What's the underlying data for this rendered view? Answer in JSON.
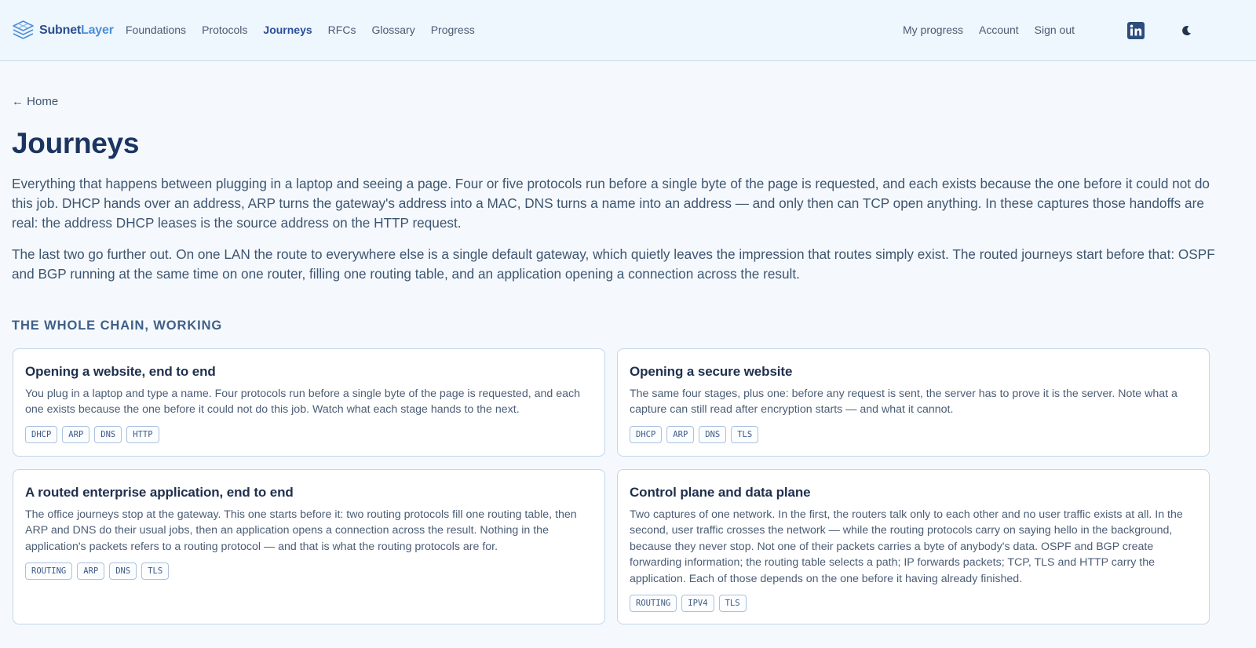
{
  "brand": {
    "name_part1": "Subnet",
    "name_part2": "Layer"
  },
  "nav": {
    "items": [
      {
        "label": "Foundations"
      },
      {
        "label": "Protocols"
      },
      {
        "label": "Journeys"
      },
      {
        "label": "RFCs"
      },
      {
        "label": "Glossary"
      },
      {
        "label": "Progress"
      }
    ],
    "active": "Journeys",
    "right": [
      {
        "label": "My progress"
      },
      {
        "label": "Account"
      },
      {
        "label": "Sign out"
      }
    ],
    "icons": [
      "linkedin-icon",
      "moon-icon"
    ]
  },
  "breadcrumb": {
    "back_label": "← Home"
  },
  "page": {
    "title": "Journeys",
    "intro_1": "Everything that happens between plugging in a laptop and seeing a page. Four or five protocols run before a single byte of the page is requested, and each exists because the one before it could not do this job. DHCP hands over an address, ARP turns the gateway's address into a MAC, DNS turns a name into an address — and only then can TCP open anything. In these captures those handoffs are real: the address DHCP leases is the source address on the HTTP request.",
    "intro_2": "The last two go further out. On one LAN the route to everywhere else is a single default gateway, which quietly leaves the impression that routes simply exist. The routed journeys start before that: OSPF and BGP running at the same time on one router, filling one routing table, and an application opening a connection across the result."
  },
  "section": {
    "heading": "THE WHOLE CHAIN, WORKING"
  },
  "cards": [
    {
      "title": "Opening a website, end to end",
      "description": "You plug in a laptop and type a name. Four protocols run before a single byte of the page is requested, and each one exists because the one before it could not do this job. Watch what each stage hands to the next.",
      "tags": [
        "DHCP",
        "ARP",
        "DNS",
        "HTTP"
      ]
    },
    {
      "title": "Opening a secure website",
      "description": "The same four stages, plus one: before any request is sent, the server has to prove it is the server. Note what a capture can still read after encryption starts — and what it cannot.",
      "tags": [
        "DHCP",
        "ARP",
        "DNS",
        "TLS"
      ]
    },
    {
      "title": "A routed enterprise application, end to end",
      "description": "The office journeys stop at the gateway. This one starts before it: two routing protocols fill one routing table, then ARP and DNS do their usual jobs, then an application opens a connection across the result. Nothing in the application's packets refers to a routing protocol — and that is what the routing protocols are for.",
      "tags": [
        "ROUTING",
        "ARP",
        "DNS",
        "TLS"
      ]
    },
    {
      "title": "Control plane and data plane",
      "description": "Two captures of one network. In the first, the routers talk only to each other and no user traffic exists at all. In the second, user traffic crosses the network — while the routing protocols carry on saying hello in the background, because they never stop. Not one of their packets carries a byte of anybody's data. OSPF and BGP create forwarding information; the routing table selects a path; IP forwards packets; TCP, TLS and HTTP carry the application. Each of those depends on the one before it having already finished.",
      "tags": [
        "ROUTING",
        "IPV4",
        "TLS"
      ]
    }
  ],
  "colors": {
    "header_bg": "#eef6fe",
    "page_bg": "#f5f9fd",
    "accent": "#2b4f9a",
    "title": "#1b3560",
    "brand_light": "#4c8fd8"
  }
}
